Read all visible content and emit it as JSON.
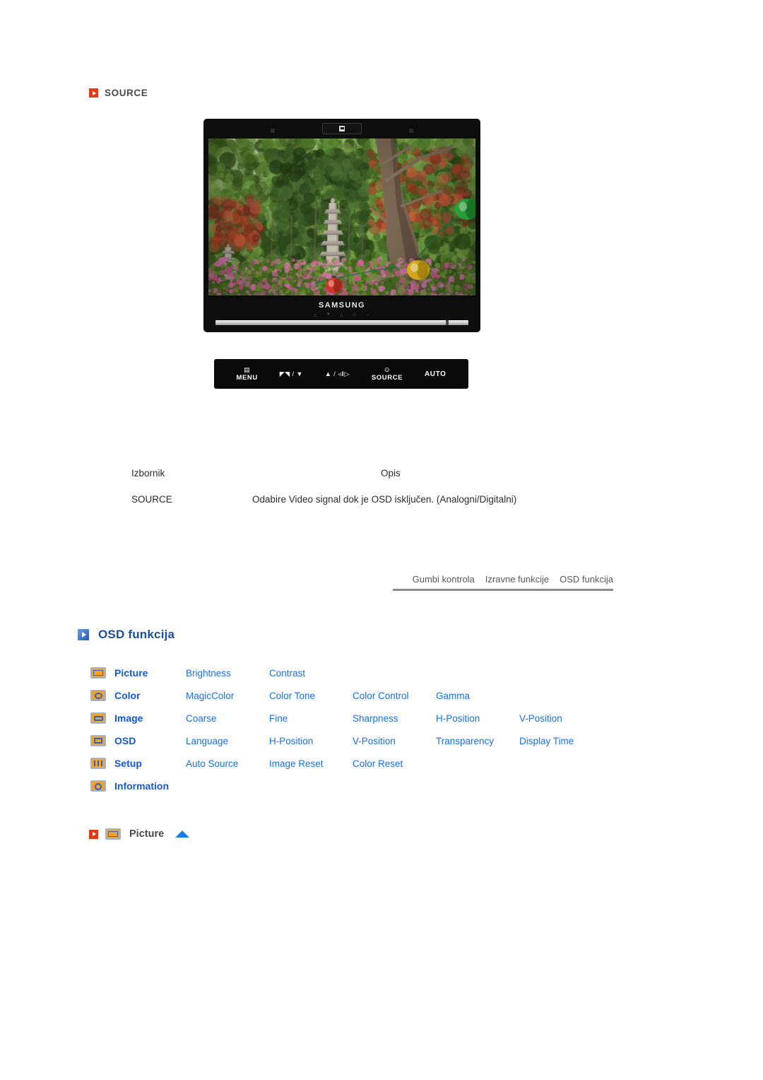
{
  "source_section": {
    "icon": "play-arrow-icon",
    "title": "SOURCE"
  },
  "monitor": {
    "brand_logo": "SAMSUNG",
    "bezel_tab_icon": "power-indicator-icon",
    "screen_alt": "garden-photo-with-stone-pagoda-and-lanterns",
    "mini_control_labels": [
      "△",
      "▼",
      "△",
      "☉",
      "→"
    ]
  },
  "button_bar": {
    "buttons": [
      {
        "glyph": "▤",
        "label": "MENU",
        "icon_name": "menu-icon"
      },
      {
        "glyph": "◤◥ / ▼",
        "label": "",
        "icon_name": "brightness-down-icon"
      },
      {
        "glyph": "▲ / ◃‖▷",
        "label": "",
        "icon_name": "volume-up-icon"
      },
      {
        "glyph": "⊙",
        "label": "SOURCE",
        "icon_name": "source-icon"
      },
      {
        "glyph": "",
        "label": "AUTO",
        "icon_name": "auto-icon"
      }
    ]
  },
  "description_table": {
    "headers": {
      "menu": "Izbornik",
      "description": "Opis"
    },
    "rows": [
      {
        "menu": "SOURCE",
        "description": "Odabire Video signal dok je OSD isključen. (Analogni/Digitalni)"
      }
    ]
  },
  "tabs": [
    {
      "label": "Gumbi kontrola"
    },
    {
      "label": "Izravne funkcije"
    },
    {
      "label": "OSD funkcija"
    }
  ],
  "osd_section": {
    "icon": "play-arrow-icon",
    "title": "OSD funkcija",
    "rows": [
      {
        "icon_name": "picture-icon",
        "category": "Picture",
        "links": [
          "Brightness",
          "Contrast"
        ]
      },
      {
        "icon_name": "color-icon",
        "category": "Color",
        "links": [
          "MagicColor",
          "Color Tone",
          "Color Control",
          "Gamma"
        ]
      },
      {
        "icon_name": "image-icon",
        "category": "Image",
        "links": [
          "Coarse",
          "Fine",
          "Sharpness",
          "H-Position",
          "V-Position"
        ]
      },
      {
        "icon_name": "osd-icon",
        "category": "OSD",
        "links": [
          "Language",
          "H-Position",
          "V-Position",
          "Transparency",
          "Display Time"
        ]
      },
      {
        "icon_name": "setup-icon",
        "category": "Setup",
        "links": [
          "Auto Source",
          "Image Reset",
          "Color Reset"
        ]
      },
      {
        "icon_name": "information-icon",
        "category": "Information",
        "links": []
      }
    ]
  },
  "picture_section": {
    "bullet_icon": "play-arrow-icon",
    "category_icon": "picture-icon",
    "title": "Picture",
    "back_to_top_icon": "up-triangle-icon"
  },
  "colors": {
    "accent_red": "#e23b17",
    "accent_blue": "#1a6fe8",
    "heading_blue": "#1d4f9e",
    "icon_orange": "#f0a22e",
    "text_gray": "#4a4a4a"
  }
}
